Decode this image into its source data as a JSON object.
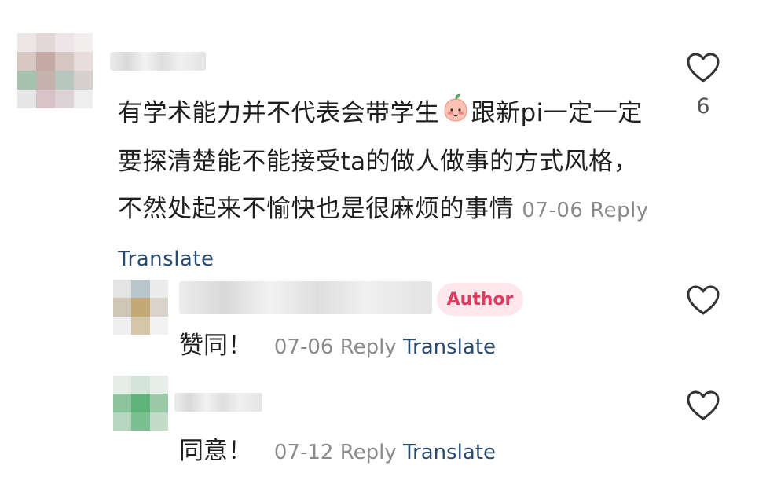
{
  "comments": {
    "main": {
      "text": "有学术能力并不代表会带学生",
      "text_after_emoji": "跟新pi一定一定要探清楚能不能接受ta的做人做事的方式风格，不然处起来不愉快也是很麻烦的事情",
      "emoji": "peach-face-emoji",
      "date": "07-06",
      "reply_label": "Reply",
      "translate_label": "Translate",
      "like_count": "6"
    },
    "reply1": {
      "badge": "Author",
      "text": "赞同！",
      "date": "07-06",
      "reply_label": "Reply",
      "translate_label": "Translate"
    },
    "reply2": {
      "text": "同意！",
      "date": "07-12",
      "reply_label": "Reply",
      "translate_label": "Translate"
    }
  },
  "icons": {
    "like": "heart-outline-icon"
  },
  "colors": {
    "author_badge_bg": "#fde7ec",
    "author_badge_text": "#e0395e",
    "translate_link": "#2b4a6f",
    "meta_gray": "#8a8a8a"
  }
}
